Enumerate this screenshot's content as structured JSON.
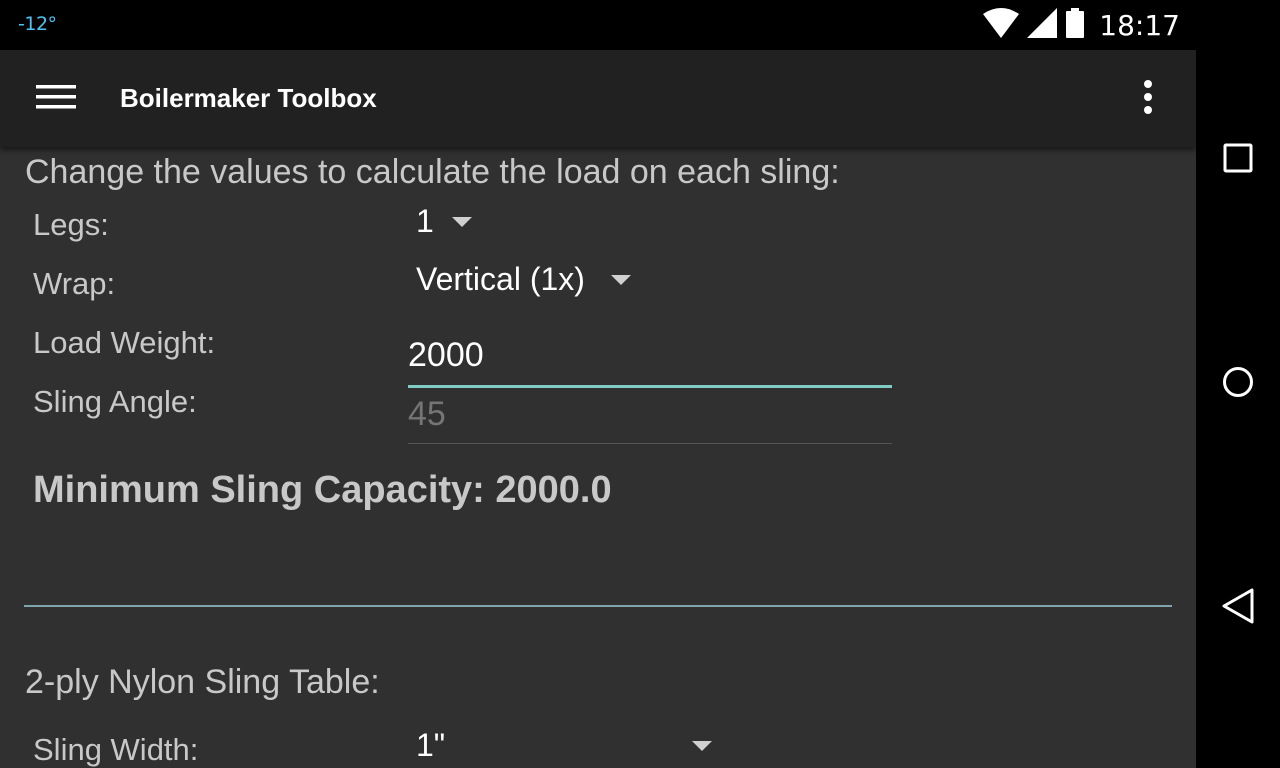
{
  "status_bar": {
    "temperature": "-12°",
    "time": "18:17",
    "icons": [
      "wifi-icon",
      "signal-icon",
      "battery-icon"
    ]
  },
  "app_bar": {
    "title": "Boilermaker Toolbox",
    "icons": [
      "hamburger-menu-icon",
      "overflow-menu-icon"
    ]
  },
  "navigation": {
    "icons": [
      "recents-icon",
      "home-icon",
      "back-icon"
    ]
  },
  "calculator": {
    "intro": "Change the values to calculate the load on each sling:",
    "legs_label": "Legs:",
    "legs_value": "1",
    "wrap_label": "Wrap:",
    "wrap_value": "Vertical (1x)",
    "load_weight_label": "Load Weight:",
    "load_weight_value": "2000",
    "sling_angle_label": "Sling Angle:",
    "sling_angle_placeholder": "45",
    "result": "Minimum Sling Capacity: 2000.0"
  },
  "sling_table": {
    "title": "2-ply Nylon Sling Table:",
    "width_label": "Sling Width:",
    "width_value": "1\""
  },
  "colors": {
    "accent": "#80cbc4",
    "app_bar": "#212121",
    "background": "#303030",
    "temperature": "#4fc3f7"
  }
}
